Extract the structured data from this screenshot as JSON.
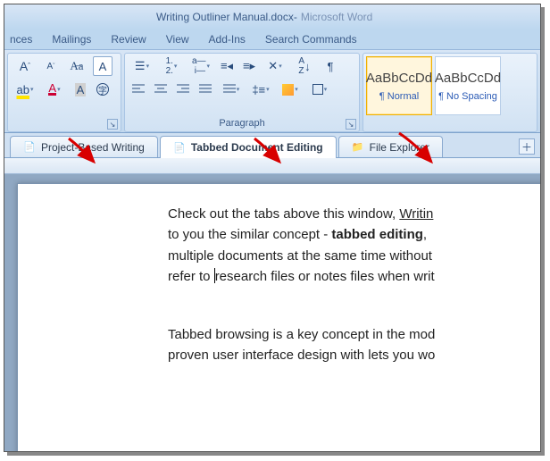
{
  "title": {
    "doc": "Writing Outliner Manual.docx",
    "sep": " - ",
    "app": "Microsoft Word"
  },
  "ribbon_tabs": [
    "nces",
    "Mailings",
    "Review",
    "View",
    "Add-Ins",
    "Search Commands"
  ],
  "paragraph_group_label": "Paragraph",
  "styles": [
    {
      "preview": "AaBbCcDd",
      "name": "¶ Normal"
    },
    {
      "preview": "AaBbCcDd",
      "name": "¶ No Spacing"
    }
  ],
  "doc_tabs": [
    {
      "label": "Project-Based Writing",
      "active": false
    },
    {
      "label": "Tabbed Document Editing",
      "active": true
    },
    {
      "label": "File Explorer",
      "active": false
    }
  ],
  "body": {
    "p1_a": "Check out the tabs above this window, ",
    "p1_link": "Writin",
    "p2_a": "to you the similar concept - ",
    "p2_b": "tabbed editing",
    "p2_c": ",",
    "p3": "multiple documents at the same time without",
    "p4_a": "refer to ",
    "p4_b": "research files or notes files when writ",
    "p5": "Tabbed browsing is a key concept in the mod",
    "p6": "proven user interface design with lets you wo"
  }
}
